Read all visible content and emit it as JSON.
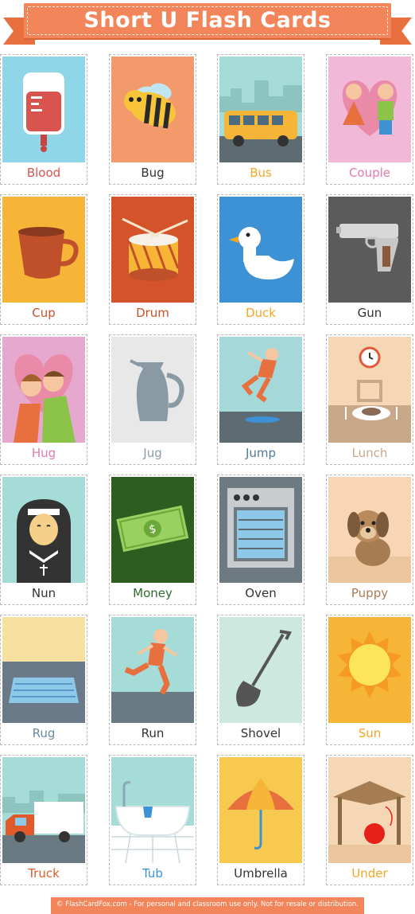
{
  "header": {
    "title": "Short U Flash Cards"
  },
  "cards": [
    {
      "word": "Blood",
      "color": "#d9534f",
      "bg": "#8ed6e8",
      "icon": "blood-bag-icon"
    },
    {
      "word": "Bug",
      "color": "#333333",
      "bg": "#f39a6c",
      "icon": "bee-icon"
    },
    {
      "word": "Bus",
      "color": "#f5a623",
      "bg": "#a5dcd8",
      "icon": "bus-icon"
    },
    {
      "word": "Couple",
      "color": "#e07ab0",
      "bg": "#f2b8d8",
      "icon": "couple-icon"
    },
    {
      "word": "Cup",
      "color": "#c8532a",
      "bg": "#f7b538",
      "icon": "cup-icon"
    },
    {
      "word": "Drum",
      "color": "#c8532a",
      "bg": "#d4532a",
      "icon": "drum-icon"
    },
    {
      "word": "Duck",
      "color": "#f5a623",
      "bg": "#3c92d4",
      "icon": "duck-icon"
    },
    {
      "word": "Gun",
      "color": "#333333",
      "bg": "#5b5b5b",
      "icon": "gun-icon"
    },
    {
      "word": "Hug",
      "color": "#e07ab0",
      "bg": "#e6a8cf",
      "icon": "hug-icon"
    },
    {
      "word": "Jug",
      "color": "#8a9aa8",
      "bg": "#e8e8e8",
      "icon": "jug-icon"
    },
    {
      "word": "Jump",
      "color": "#4f7a9a",
      "bg": "#a5d8d8",
      "icon": "jump-icon"
    },
    {
      "word": "Lunch",
      "color": "#c9a88a",
      "bg": "#f5d7b6",
      "icon": "lunch-icon"
    },
    {
      "word": "Nun",
      "color": "#333333",
      "bg": "#a5dcd8",
      "icon": "nun-icon"
    },
    {
      "word": "Money",
      "color": "#2e6b2e",
      "bg": "#2e5d1f",
      "icon": "money-icon"
    },
    {
      "word": "Oven",
      "color": "#333333",
      "bg": "#6e7a82",
      "icon": "oven-icon"
    },
    {
      "word": "Puppy",
      "color": "#a67c52",
      "bg": "#f8d5b5",
      "icon": "puppy-icon"
    },
    {
      "word": "Rug",
      "color": "#6a8aa0",
      "bg": "#f8e0a0",
      "icon": "rug-icon"
    },
    {
      "word": "Run",
      "color": "#333333",
      "bg": "#a5dcd8",
      "icon": "run-icon"
    },
    {
      "word": "Shovel",
      "color": "#333333",
      "bg": "#cde8df",
      "icon": "shovel-icon"
    },
    {
      "word": "Sun",
      "color": "#f5a623",
      "bg": "#f7b538",
      "icon": "sun-icon"
    },
    {
      "word": "Truck",
      "color": "#e05a2a",
      "bg": "#a5dcd8",
      "icon": "truck-icon"
    },
    {
      "word": "Tub",
      "color": "#3c92d4",
      "bg": "#a5dcd8",
      "icon": "bathtub-icon"
    },
    {
      "word": "Umbrella",
      "color": "#333333",
      "bg": "#f7c94e",
      "icon": "umbrella-icon"
    },
    {
      "word": "Under",
      "color": "#f5a623",
      "bg": "#f5d7b6",
      "icon": "table-ball-icon"
    }
  ],
  "footer": {
    "text": "© FlashCardFox.com - For personal and classroom use only. Not for resale or distribution."
  }
}
